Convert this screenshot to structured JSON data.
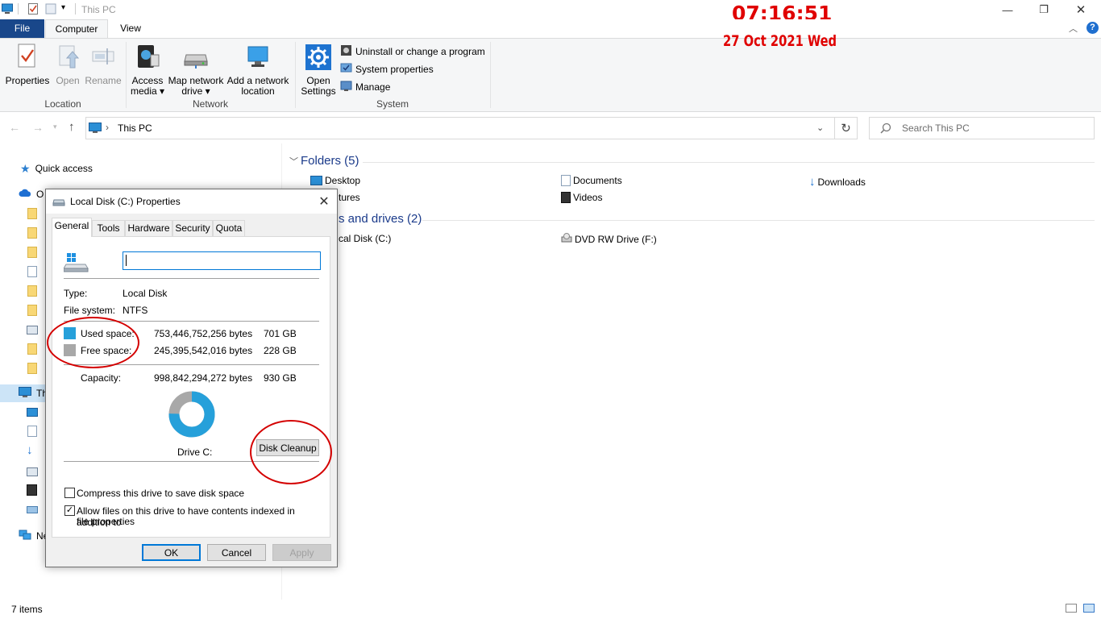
{
  "window": {
    "title": "This PC",
    "controls": {
      "minimize": "—",
      "restore": "❐",
      "close": "✕"
    }
  },
  "clock": {
    "time": "07:16:51",
    "date": "27 Oct 2021 Wed"
  },
  "ribbon": {
    "tabs": {
      "file": "File",
      "computer": "Computer",
      "view": "View"
    },
    "location": {
      "label": "Location",
      "properties": "Properties",
      "open": "Open",
      "rename": "Rename"
    },
    "network": {
      "label": "Network",
      "access_media": [
        "Access",
        "media ▾"
      ],
      "map_drive": [
        "Map network",
        "drive ▾"
      ],
      "add_location": [
        "Add a network",
        "location"
      ]
    },
    "system": {
      "label": "System",
      "open_settings": [
        "Open",
        "Settings"
      ],
      "uninstall": "Uninstall or change a program",
      "system_properties": "System properties",
      "manage": "Manage"
    }
  },
  "address": {
    "path": "This PC",
    "search_placeholder": "Search This PC"
  },
  "navpane": {
    "quick_access": "Quick access",
    "onedrive": "O",
    "this_pc": "Th",
    "network": "Ne"
  },
  "content": {
    "folders_header": "Folders (5)",
    "folders": {
      "desktop": "Desktop",
      "documents": "Documents",
      "downloads": "Downloads",
      "pictures": "tures",
      "videos": "Videos"
    },
    "drives_header": "s and drives (2)",
    "drives": {
      "local": "cal Disk (C:)",
      "dvd": "DVD RW Drive (F:)"
    }
  },
  "status": {
    "items": "7 items"
  },
  "dialog": {
    "title": "Local Disk (C:) Properties",
    "tabs": {
      "general": "General",
      "tools": "Tools",
      "hardware": "Hardware",
      "security": "Security",
      "quota": "Quota"
    },
    "name_value": "",
    "type_label": "Type:",
    "type_value": "Local Disk",
    "fs_label": "File system:",
    "fs_value": "NTFS",
    "used_label": "Used space:",
    "used_bytes": "753,446,752,256 bytes",
    "used_gb": "701 GB",
    "free_label": "Free space:",
    "free_bytes": "245,395,542,016 bytes",
    "free_gb": "228 GB",
    "capacity_label": "Capacity:",
    "capacity_bytes": "998,842,294,272 bytes",
    "capacity_gb": "930 GB",
    "drive_label": "Drive C:",
    "used_fraction": 0.754,
    "disk_cleanup": "Disk Cleanup",
    "compress_label": "Compress this drive to save disk space",
    "compress_checked": false,
    "index_label_1": "Allow files on this drive to have contents indexed in addition to",
    "index_label_2": "file properties",
    "index_checked": true,
    "ok": "OK",
    "cancel": "Cancel",
    "apply": "Apply"
  },
  "colors": {
    "used": "#26a0da",
    "free": "#a8a8a8",
    "annotation": "#d40000",
    "file_tab": "#19478a"
  }
}
